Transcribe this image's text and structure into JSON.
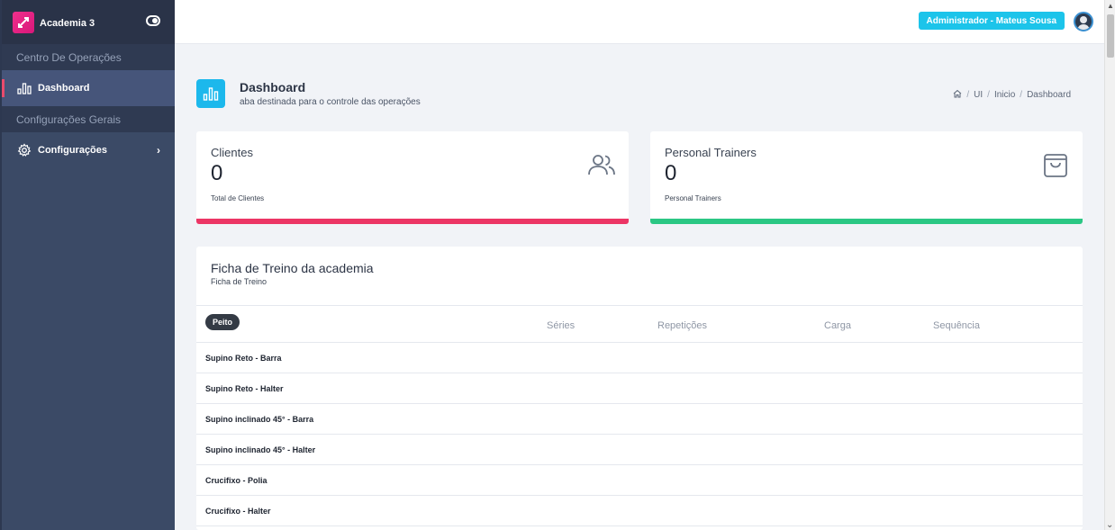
{
  "sidebar": {
    "brand": "Academia 3",
    "sections": {
      "operations": "Centro De Operações",
      "settings": "Configurações Gerais"
    },
    "items": [
      {
        "label": "Dashboard",
        "icon": "bar-chart-icon",
        "active": true
      },
      {
        "label": "Configurações",
        "icon": "gear-icon",
        "active": false
      }
    ]
  },
  "header": {
    "admin_label": "Administrador - Mateus Sousa"
  },
  "page": {
    "title": "Dashboard",
    "subtitle": "aba destinada para o controle das operações",
    "breadcrumb": [
      "UI",
      "Inicio",
      "Dashboard"
    ]
  },
  "cards": [
    {
      "label": "Clientes",
      "value": "0",
      "desc": "Total de Clientes",
      "icon": "users-icon",
      "color": "#ec3565"
    },
    {
      "label": "Personal Trainers",
      "value": "0",
      "desc": "Personal Trainers",
      "icon": "shopping-bag-icon",
      "color": "#2bc784"
    }
  ],
  "workout": {
    "title": "Ficha de Treino da academia",
    "subtitle": "Ficha de Treino",
    "group_badge": "Peito",
    "columns": [
      "Séries",
      "Repetições",
      "Carga",
      "Sequência"
    ],
    "rows": [
      "Supino Reto - Barra",
      "Supino Reto - Halter",
      "Supino inclinado 45° - Barra",
      "Supino inclinado 45° - Halter",
      "Crucifixo - Polia",
      "Crucifixo - Halter"
    ]
  },
  "colors": {
    "accent": "#1cc4ea",
    "sidebar": "#3b4a66"
  }
}
